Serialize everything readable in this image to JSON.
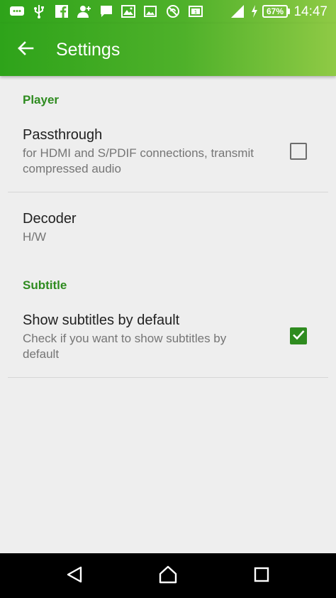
{
  "status_bar": {
    "battery": "67%",
    "time": "14:47",
    "icons": [
      "message-icon",
      "usb-icon",
      "facebook-icon",
      "add-contact-icon",
      "chat-icon",
      "gallery-icon",
      "image-icon",
      "sync-blocked-icon",
      "cast-icon",
      "signal-icon",
      "charging-icon"
    ]
  },
  "app_bar": {
    "title": "Settings",
    "back_icon": "arrow-back-icon"
  },
  "sections": {
    "player": {
      "header": "Player",
      "passthrough": {
        "title": "Passthrough",
        "summary": "for HDMI and S/PDIF connections, transmit compressed audio",
        "checked": false
      },
      "decoder": {
        "title": "Decoder",
        "summary": "H/W"
      }
    },
    "subtitle": {
      "header": "Subtitle",
      "show_by_default": {
        "title": "Show subtitles by default",
        "summary": "Check if you want to show subtitles by default",
        "checked": true
      }
    }
  },
  "colors": {
    "accent": "#2e8b1f",
    "toolbar_start": "#2ea31a",
    "toolbar_end": "#8fca45",
    "background": "#eeeeee"
  },
  "nav_bar": {
    "icons": [
      "back-triangle-icon",
      "home-icon",
      "recents-icon"
    ]
  }
}
